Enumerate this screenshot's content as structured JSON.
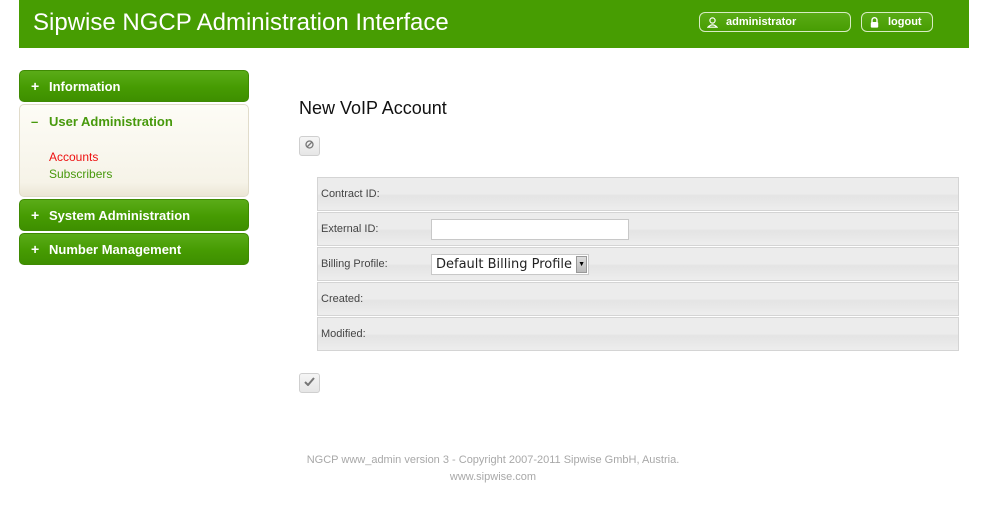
{
  "header": {
    "title": "Sipwise NGCP Administration Interface",
    "user_label": "administrator",
    "user_icon": "user-icon",
    "logout_label": "logout",
    "logout_icon": "lock-icon"
  },
  "sidebar": {
    "sections": [
      {
        "label": "Information",
        "sign": "+",
        "expanded": false
      },
      {
        "label": "User Administration",
        "sign": "–",
        "expanded": true,
        "items": [
          {
            "label": "Accounts",
            "active": true
          },
          {
            "label": "Subscribers",
            "active": false
          }
        ]
      },
      {
        "label": "System Administration",
        "sign": "+",
        "expanded": false
      },
      {
        "label": "Number Management",
        "sign": "+",
        "expanded": false
      }
    ]
  },
  "main": {
    "title": "New VoIP Account",
    "cancel_icon": "cancel-icon",
    "save_icon": "checkmark-icon",
    "form": {
      "contract_id_label": "Contract ID:",
      "external_id_label": "External ID:",
      "external_id_value": "",
      "billing_profile_label": "Billing Profile:",
      "billing_profile_selected": "Default Billing Profile",
      "created_label": "Created:",
      "modified_label": "Modified:"
    }
  },
  "footer": {
    "copyright": "NGCP www_admin version 3 - Copyright 2007-2011 Sipwise GmbH, Austria.",
    "website": "www.sipwise.com"
  },
  "colors": {
    "brand_green": "#479d02",
    "active_link": "#ee1111",
    "link_green": "#47990c"
  }
}
